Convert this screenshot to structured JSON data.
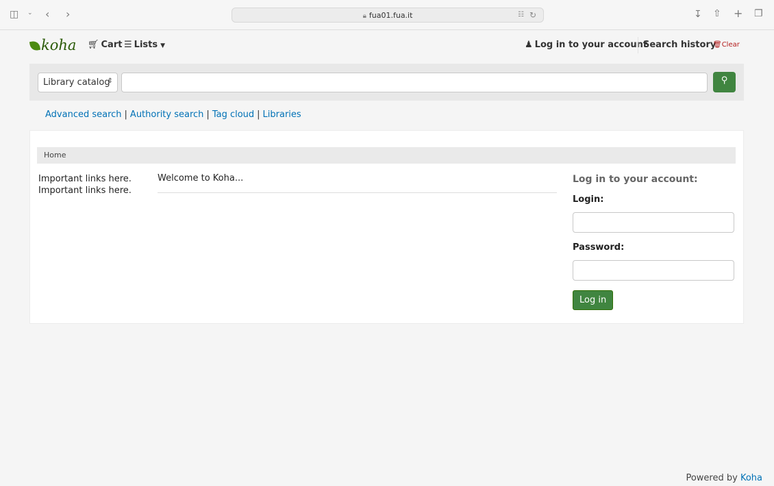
{
  "browser": {
    "url": "fua01.fua.it"
  },
  "header": {
    "logo_text": "koha",
    "cart_label": "Cart",
    "lists_label": "Lists",
    "login_link": "Log in to your account",
    "search_history": "Search history",
    "clear_label": "Clear"
  },
  "search": {
    "catalog_select": "Library catalog",
    "query_value": ""
  },
  "more_searches": {
    "advanced": "Advanced search",
    "authority": "Authority search",
    "tag_cloud": "Tag cloud",
    "libraries": "Libraries",
    "separator": "|"
  },
  "breadcrumb": {
    "home": "Home"
  },
  "main": {
    "links": [
      "Important links here.",
      "Important links here."
    ],
    "welcome": "Welcome to Koha..."
  },
  "login": {
    "title": "Log in to your account:",
    "login_label": "Login:",
    "password_label": "Password:",
    "button": "Log in"
  },
  "footer": {
    "powered_by": "Powered by",
    "koha_link": "Koha"
  }
}
